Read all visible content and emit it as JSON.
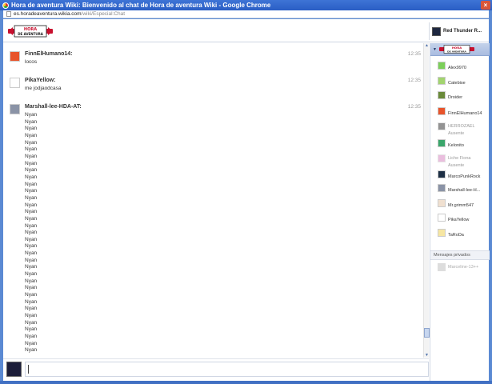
{
  "window": {
    "title": "Hora de aventura Wiki: Bienvenido al chat de Hora de aventura Wiki - Google Chrome",
    "close": "×"
  },
  "address": {
    "host": "es.horadeaventura.wikia.com",
    "path": "/wiki/Especial:Chat"
  },
  "header": {
    "logo_text": "HORA DE AVENTURA",
    "current_user": "Red Thunder R..."
  },
  "messages": [
    {
      "user": "FinnElHumano14:",
      "time": "12:35",
      "lines": [
        "locos"
      ],
      "avatar_color": "#e8542b"
    },
    {
      "user": "PikaYellow:",
      "time": "12:35",
      "lines": [
        "me jodjaodcasa"
      ],
      "avatar_color": "#ffffff"
    },
    {
      "user": "Marshall-lee-HDA-AT:",
      "time": "12:35",
      "lines": [
        "Nyan",
        "Nyan",
        "Nyan",
        "Nyan",
        "Nyan",
        "Nyan",
        "Nyan",
        "Nyan",
        "Nyan",
        "Nyan",
        "Nyan",
        "Nyan",
        "Nyan",
        "Nyan",
        "Nyan",
        "Nyan",
        "Nyan",
        "Nyan",
        "Nyan",
        "Nyan",
        "Nyan",
        "Nyan",
        "Nyan",
        "Nyan",
        "Nyan",
        "Nyan",
        "Nyan",
        "Nyan",
        "Nyan",
        "Nyan",
        "Nyan",
        "Nyan",
        "Nyan",
        "Nyan",
        "Nyan"
      ],
      "avatar_color": "#8a93a6"
    }
  ],
  "sidebar": {
    "logo_text": "HORA DE AVENTURA",
    "users": [
      {
        "name": "Alex9970",
        "status": "",
        "color": "#7ccf5a"
      },
      {
        "name": "Catebise",
        "status": "",
        "color": "#a2d46f"
      },
      {
        "name": "Droider",
        "status": "",
        "color": "#6a8a3a"
      },
      {
        "name": "FinnElHumano14",
        "status": "",
        "color": "#e8542b"
      },
      {
        "name": "HERROZAEL",
        "status": "Ausente",
        "color": "#2a2a2a"
      },
      {
        "name": "Kelonito",
        "status": "",
        "color": "#3aa66b"
      },
      {
        "name": "Liche Fiona",
        "status": "Ausente",
        "color": "#d77fbf"
      },
      {
        "name": "MarcoPunkRock",
        "status": "",
        "color": "#1d2f45"
      },
      {
        "name": "Marshall-lee-H...",
        "status": "",
        "color": "#8a93a6"
      },
      {
        "name": "Mr.grimm547",
        "status": "",
        "color": "#f0e0d0"
      },
      {
        "name": "PikaYellow",
        "status": "",
        "color": "#ffffff"
      },
      {
        "name": "TaRoDa",
        "status": "",
        "color": "#f6e6a2"
      }
    ],
    "private_header": "Mensajes privados",
    "private_user": "Marceline-13++"
  }
}
